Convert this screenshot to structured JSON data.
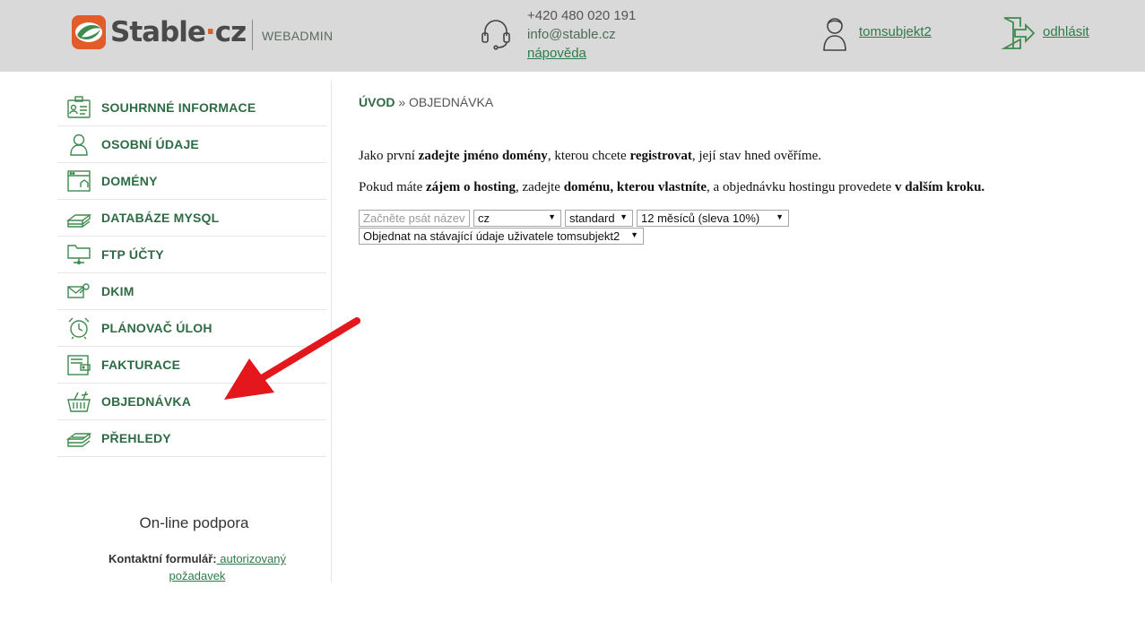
{
  "header": {
    "logo_text_main": "Stable",
    "logo_text_dot": "·",
    "logo_text_tld": "cz",
    "section": "WEBADMIN",
    "phone": "+420 480 020 191",
    "email": "info@stable.cz",
    "help": "nápověda",
    "username": "tomsubjekt2",
    "logout": "odhlásit"
  },
  "sidebar": {
    "items": [
      {
        "label": "SOUHRNNÉ INFORMACE",
        "icon": "summary-card-icon"
      },
      {
        "label": "OSOBNÍ ÚDAJE",
        "icon": "person-icon"
      },
      {
        "label": "DOMÉNY",
        "icon": "browser-window-icon"
      },
      {
        "label": "DATABÁZE MYSQL",
        "icon": "database-layers-icon"
      },
      {
        "label": "FTP ÚČTY",
        "icon": "ftp-folder-icon"
      },
      {
        "label": "DKIM",
        "icon": "envelope-key-icon"
      },
      {
        "label": "PLÁNOVAČ ÚLOH",
        "icon": "alarm-clock-icon"
      },
      {
        "label": "FAKTURACE",
        "icon": "invoice-wallet-icon"
      },
      {
        "label": "OBJEDNÁVKA",
        "icon": "shopping-basket-icon"
      },
      {
        "label": "PŘEHLEDY",
        "icon": "reports-layers-icon"
      }
    ],
    "support_title": "On-line podpora",
    "support_label": "Kontaktní formulář:",
    "support_link": " autorizovaný požadavek"
  },
  "main": {
    "breadcrumb_home": "ÚVOD",
    "breadcrumb_sep": " » ",
    "breadcrumb_current": "OBJEDNÁVKA",
    "p1": {
      "t1": "Jako první ",
      "b1": "zadejte jméno domény",
      "t2": ", kterou chcete ",
      "b2": "registrovat",
      "t3": ", její stav hned ověříme."
    },
    "p2": {
      "t1": "Pokud máte ",
      "b1": "zájem o hosting",
      "t2": ", zadejte ",
      "b2": "doménu, kterou vlastníte",
      "t3": ", a objednávku hostingu provedete ",
      "b3": "v dalším kroku."
    },
    "form": {
      "domain_placeholder": "Začněte psát název",
      "tld_value": "cz",
      "plan_value": "standard",
      "period_value": "12 měsíců (sleva 10%)",
      "order_value": "Objednat na stávající údaje uživatele tomsubjekt2"
    }
  },
  "colors": {
    "accent_green": "#2e6b45",
    "header_bg": "#d9d9d9",
    "logo_orange": "#e25b2a",
    "annotation_red": "#e3171c"
  }
}
